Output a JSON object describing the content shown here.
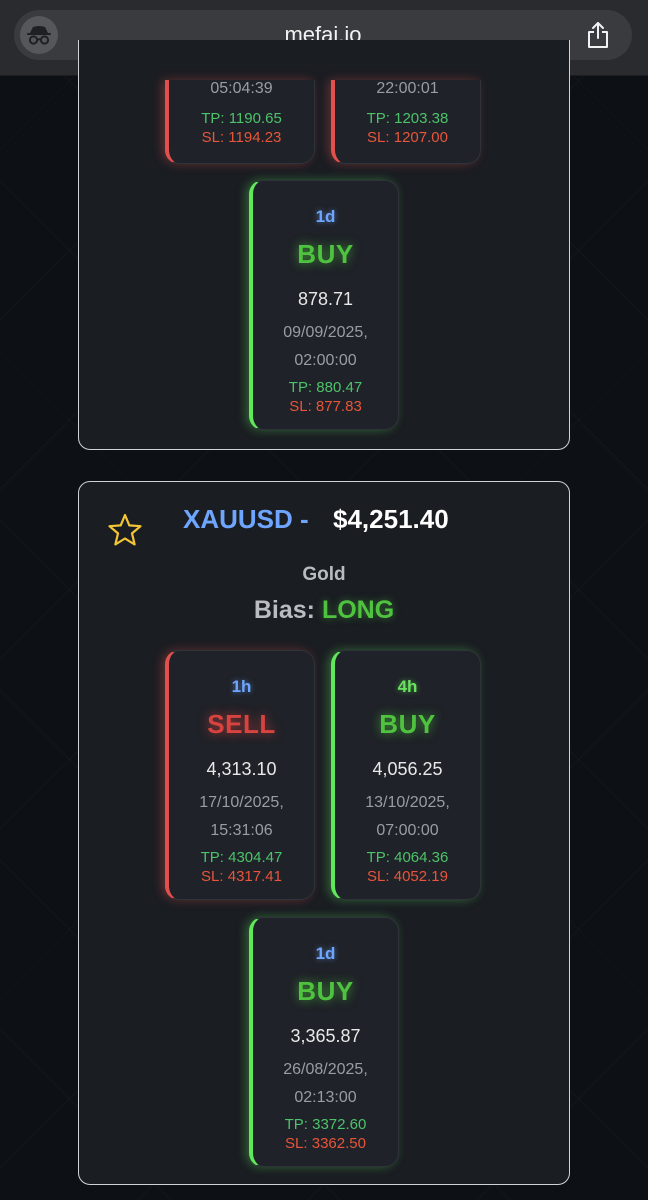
{
  "browser": {
    "url": "mefai.io"
  },
  "top_asset": {
    "partial_signals": [
      {
        "date_tail": "05:04:39",
        "tp": "TP: 1190.65",
        "sl": "SL: 1194.23"
      },
      {
        "date_tail": "22:00:01",
        "tp": "TP: 1203.38",
        "sl": "SL: 1207.00"
      }
    ],
    "signal_1d": {
      "timeframe": "1d",
      "action": "BUY",
      "price": "878.71",
      "date_line1": "09/09/2025,",
      "date_line2": "02:00:00",
      "tp": "TP: 880.47",
      "sl": "SL: 877.83"
    }
  },
  "gold_asset": {
    "symbol": "XAUUSD -",
    "price": "$4,251.40",
    "name": "Gold",
    "bias_label": "Bias:",
    "bias_value": "LONG",
    "signals": [
      {
        "timeframe": "1h",
        "action": "SELL",
        "price": "4,313.10",
        "date_line1": "17/10/2025,",
        "date_line2": "15:31:06",
        "tp": "TP: 4304.47",
        "sl": "SL: 4317.41"
      },
      {
        "timeframe": "4h",
        "action": "BUY",
        "price": "4,056.25",
        "date_line1": "13/10/2025,",
        "date_line2": "07:00:00",
        "tp": "TP: 4064.36",
        "sl": "SL: 4052.19"
      },
      {
        "timeframe": "1d",
        "action": "BUY",
        "price": "3,365.87",
        "date_line1": "26/08/2025,",
        "date_line2": "02:13:00",
        "tp": "TP: 3372.60",
        "sl": "SL: 3362.50"
      }
    ]
  },
  "colors": {
    "buy": "#4fc33f",
    "sell": "#d9433f",
    "symbol": "#6ea6ff"
  }
}
